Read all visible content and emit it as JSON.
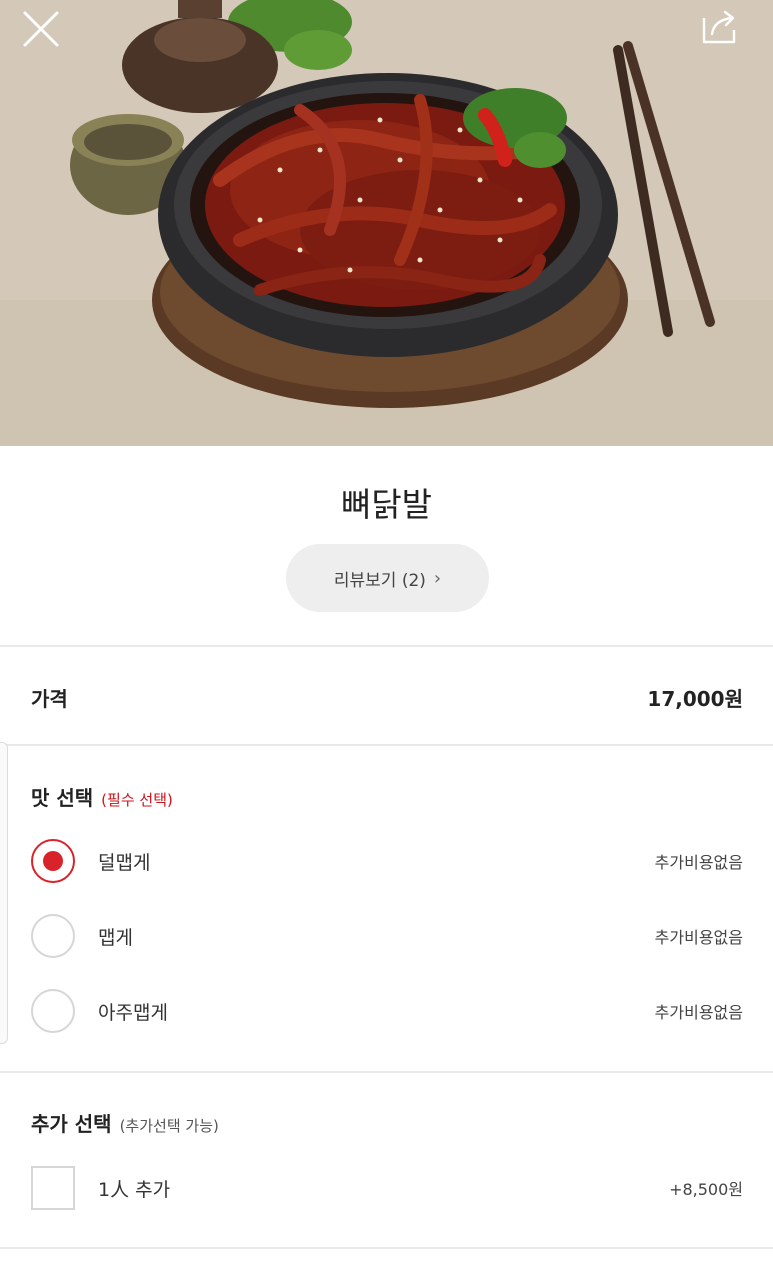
{
  "header": {
    "close_icon": "close-icon",
    "share_icon": "share-icon"
  },
  "product": {
    "name": "뼈닭발",
    "review_button": "리뷰보기 (2)",
    "review_chevron": "›"
  },
  "price": {
    "label": "가격",
    "value": "17,000원"
  },
  "taste": {
    "title": "맛 선택",
    "required_note": "(필수 선택)",
    "options": [
      {
        "label": "덜맵게",
        "price": "추가비용없음",
        "selected": true
      },
      {
        "label": "맵게",
        "price": "추가비용없음",
        "selected": false
      },
      {
        "label": "아주맵게",
        "price": "추가비용없음",
        "selected": false
      }
    ]
  },
  "extra": {
    "title": "추가 선택",
    "optional_note": "(추가선택 가능)",
    "options": [
      {
        "label": "1人 추가",
        "price": "+8,500원",
        "checked": false
      }
    ]
  },
  "colors": {
    "accent": "#d8232a",
    "required_text": "#d0121b"
  }
}
